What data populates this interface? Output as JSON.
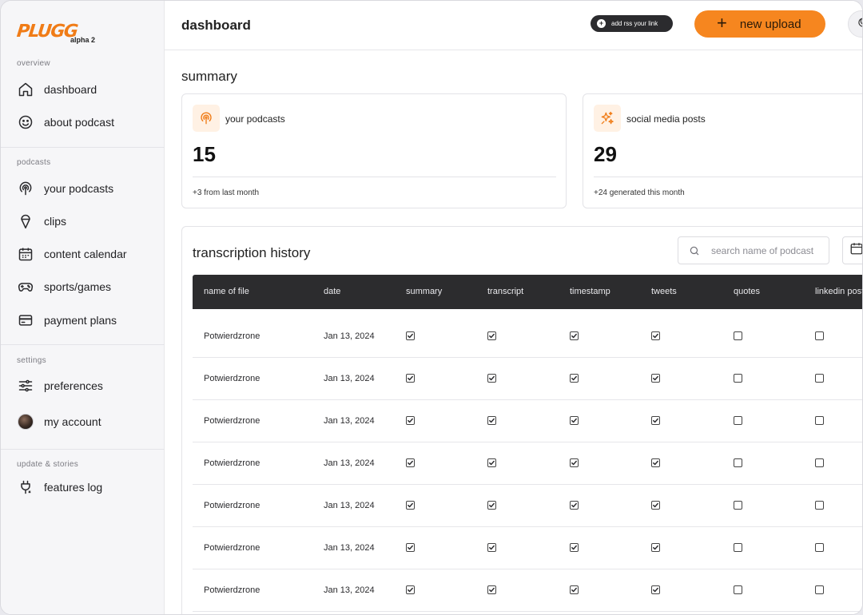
{
  "app": {
    "logo": "PLUGG",
    "badge": "alpha 2"
  },
  "sidebar": {
    "sections": {
      "overview": "overview",
      "podcasts": "podcasts",
      "settings": "settings",
      "updates": "update & stories"
    },
    "items": {
      "dashboard": "dashboard",
      "about": "about podcast",
      "your_podcasts": "your podcasts",
      "clips": "clips",
      "calendar": "content calendar",
      "sports": "sports/games",
      "payment": "payment plans",
      "preferences": "preferences",
      "account": "my account",
      "features": "features log"
    }
  },
  "header": {
    "title": "dashboard",
    "rss_label": "add rss your link",
    "upload_label": "new upload"
  },
  "summary": {
    "title": "summary",
    "cards": [
      {
        "label": "your podcasts",
        "value": "15",
        "note": "+3 from last month",
        "icon": "podcast-icon"
      },
      {
        "label": "social media posts",
        "value": "29",
        "note": "+24 generated this month",
        "icon": "sparkle-icon"
      }
    ]
  },
  "history": {
    "title": "transcription history",
    "search_placeholder": "search name of podcast",
    "columns": [
      "name of file",
      "date",
      "summary",
      "transcript",
      "timestamp",
      "tweets",
      "quotes",
      "linkedin posts"
    ],
    "rows": [
      {
        "name": "Potwierdzrone",
        "date": "Jan 13, 2024",
        "checks": [
          true,
          true,
          true,
          true,
          false,
          false
        ]
      },
      {
        "name": "Potwierdzrone",
        "date": "Jan 13, 2024",
        "checks": [
          true,
          true,
          true,
          true,
          false,
          false
        ]
      },
      {
        "name": "Potwierdzrone",
        "date": "Jan 13, 2024",
        "checks": [
          true,
          true,
          true,
          true,
          false,
          false
        ]
      },
      {
        "name": "Potwierdzrone",
        "date": "Jan 13, 2024",
        "checks": [
          true,
          true,
          true,
          true,
          false,
          false
        ]
      },
      {
        "name": "Potwierdzrone",
        "date": "Jan 13, 2024",
        "checks": [
          true,
          true,
          true,
          true,
          false,
          false
        ]
      },
      {
        "name": "Potwierdzrone",
        "date": "Jan 13, 2024",
        "checks": [
          true,
          true,
          true,
          true,
          false,
          false
        ]
      },
      {
        "name": "Potwierdzrone",
        "date": "Jan 13, 2024",
        "checks": [
          true,
          true,
          true,
          true,
          false,
          false
        ]
      }
    ]
  },
  "colors": {
    "accent": "#f6861f",
    "brand": "#f07c17",
    "table_header": "#2c2c2e"
  }
}
